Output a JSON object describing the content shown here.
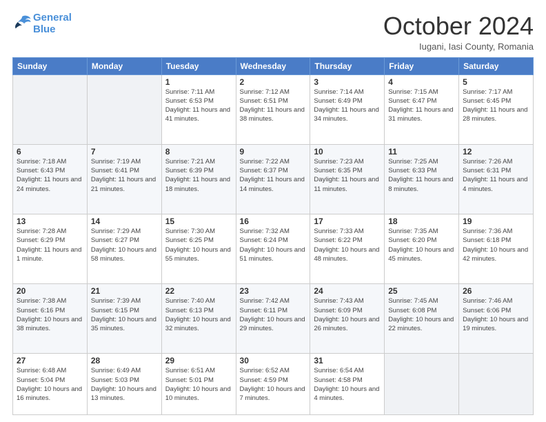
{
  "logo": {
    "line1": "General",
    "line2": "Blue"
  },
  "header": {
    "month": "October 2024",
    "location": "Iugani, Iasi County, Romania"
  },
  "weekdays": [
    "Sunday",
    "Monday",
    "Tuesday",
    "Wednesday",
    "Thursday",
    "Friday",
    "Saturday"
  ],
  "weeks": [
    [
      {
        "day": "",
        "info": ""
      },
      {
        "day": "",
        "info": ""
      },
      {
        "day": "1",
        "info": "Sunrise: 7:11 AM\nSunset: 6:53 PM\nDaylight: 11 hours and 41 minutes."
      },
      {
        "day": "2",
        "info": "Sunrise: 7:12 AM\nSunset: 6:51 PM\nDaylight: 11 hours and 38 minutes."
      },
      {
        "day": "3",
        "info": "Sunrise: 7:14 AM\nSunset: 6:49 PM\nDaylight: 11 hours and 34 minutes."
      },
      {
        "day": "4",
        "info": "Sunrise: 7:15 AM\nSunset: 6:47 PM\nDaylight: 11 hours and 31 minutes."
      },
      {
        "day": "5",
        "info": "Sunrise: 7:17 AM\nSunset: 6:45 PM\nDaylight: 11 hours and 28 minutes."
      }
    ],
    [
      {
        "day": "6",
        "info": "Sunrise: 7:18 AM\nSunset: 6:43 PM\nDaylight: 11 hours and 24 minutes."
      },
      {
        "day": "7",
        "info": "Sunrise: 7:19 AM\nSunset: 6:41 PM\nDaylight: 11 hours and 21 minutes."
      },
      {
        "day": "8",
        "info": "Sunrise: 7:21 AM\nSunset: 6:39 PM\nDaylight: 11 hours and 18 minutes."
      },
      {
        "day": "9",
        "info": "Sunrise: 7:22 AM\nSunset: 6:37 PM\nDaylight: 11 hours and 14 minutes."
      },
      {
        "day": "10",
        "info": "Sunrise: 7:23 AM\nSunset: 6:35 PM\nDaylight: 11 hours and 11 minutes."
      },
      {
        "day": "11",
        "info": "Sunrise: 7:25 AM\nSunset: 6:33 PM\nDaylight: 11 hours and 8 minutes."
      },
      {
        "day": "12",
        "info": "Sunrise: 7:26 AM\nSunset: 6:31 PM\nDaylight: 11 hours and 4 minutes."
      }
    ],
    [
      {
        "day": "13",
        "info": "Sunrise: 7:28 AM\nSunset: 6:29 PM\nDaylight: 11 hours and 1 minute."
      },
      {
        "day": "14",
        "info": "Sunrise: 7:29 AM\nSunset: 6:27 PM\nDaylight: 10 hours and 58 minutes."
      },
      {
        "day": "15",
        "info": "Sunrise: 7:30 AM\nSunset: 6:25 PM\nDaylight: 10 hours and 55 minutes."
      },
      {
        "day": "16",
        "info": "Sunrise: 7:32 AM\nSunset: 6:24 PM\nDaylight: 10 hours and 51 minutes."
      },
      {
        "day": "17",
        "info": "Sunrise: 7:33 AM\nSunset: 6:22 PM\nDaylight: 10 hours and 48 minutes."
      },
      {
        "day": "18",
        "info": "Sunrise: 7:35 AM\nSunset: 6:20 PM\nDaylight: 10 hours and 45 minutes."
      },
      {
        "day": "19",
        "info": "Sunrise: 7:36 AM\nSunset: 6:18 PM\nDaylight: 10 hours and 42 minutes."
      }
    ],
    [
      {
        "day": "20",
        "info": "Sunrise: 7:38 AM\nSunset: 6:16 PM\nDaylight: 10 hours and 38 minutes."
      },
      {
        "day": "21",
        "info": "Sunrise: 7:39 AM\nSunset: 6:15 PM\nDaylight: 10 hours and 35 minutes."
      },
      {
        "day": "22",
        "info": "Sunrise: 7:40 AM\nSunset: 6:13 PM\nDaylight: 10 hours and 32 minutes."
      },
      {
        "day": "23",
        "info": "Sunrise: 7:42 AM\nSunset: 6:11 PM\nDaylight: 10 hours and 29 minutes."
      },
      {
        "day": "24",
        "info": "Sunrise: 7:43 AM\nSunset: 6:09 PM\nDaylight: 10 hours and 26 minutes."
      },
      {
        "day": "25",
        "info": "Sunrise: 7:45 AM\nSunset: 6:08 PM\nDaylight: 10 hours and 22 minutes."
      },
      {
        "day": "26",
        "info": "Sunrise: 7:46 AM\nSunset: 6:06 PM\nDaylight: 10 hours and 19 minutes."
      }
    ],
    [
      {
        "day": "27",
        "info": "Sunrise: 6:48 AM\nSunset: 5:04 PM\nDaylight: 10 hours and 16 minutes."
      },
      {
        "day": "28",
        "info": "Sunrise: 6:49 AM\nSunset: 5:03 PM\nDaylight: 10 hours and 13 minutes."
      },
      {
        "day": "29",
        "info": "Sunrise: 6:51 AM\nSunset: 5:01 PM\nDaylight: 10 hours and 10 minutes."
      },
      {
        "day": "30",
        "info": "Sunrise: 6:52 AM\nSunset: 4:59 PM\nDaylight: 10 hours and 7 minutes."
      },
      {
        "day": "31",
        "info": "Sunrise: 6:54 AM\nSunset: 4:58 PM\nDaylight: 10 hours and 4 minutes."
      },
      {
        "day": "",
        "info": ""
      },
      {
        "day": "",
        "info": ""
      }
    ]
  ]
}
